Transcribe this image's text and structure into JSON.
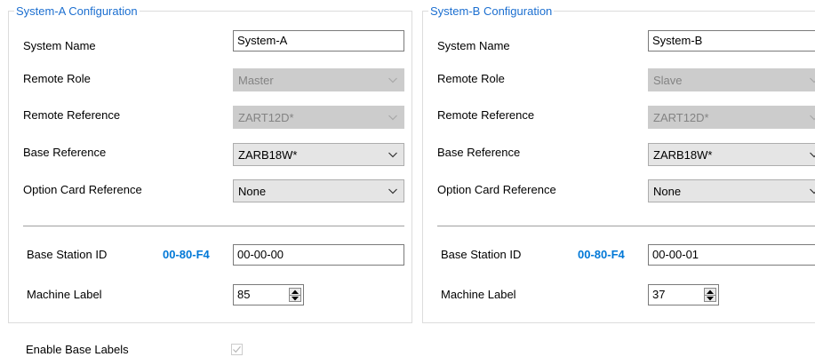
{
  "systemA": {
    "title": "System-A Configuration",
    "labels": {
      "system_name": "System Name",
      "remote_role": "Remote Role",
      "remote_reference": "Remote Reference",
      "base_reference": "Base Reference",
      "option_card_reference": "Option Card Reference",
      "base_station_id": "Base Station ID",
      "machine_label": "Machine Label"
    },
    "system_name": "System-A",
    "remote_role": "Master",
    "remote_reference": "ZART12D*",
    "base_reference": "ZARB18W*",
    "option_card_reference": "None",
    "mac_prefix": "00-80-F4",
    "base_station_id": "00-00-00",
    "machine_label": "85"
  },
  "systemB": {
    "title": "System-B Configuration",
    "labels": {
      "system_name": "System Name",
      "remote_role": "Remote Role",
      "remote_reference": "Remote Reference",
      "base_reference": "Base Reference",
      "option_card_reference": "Option Card Reference",
      "base_station_id": "Base Station ID",
      "machine_label": "Machine Label"
    },
    "system_name": "System-B",
    "remote_role": "Slave",
    "remote_reference": "ZART12D*",
    "base_reference": "ZARB18W*",
    "option_card_reference": "None",
    "mac_prefix": "00-80-F4",
    "base_station_id": "00-00-01",
    "machine_label": "37"
  },
  "enable_base_labels": {
    "label": "Enable Base Labels",
    "checked": true,
    "enabled": false
  },
  "colors": {
    "legend": "#1c6fd0",
    "mac_prefix": "#0078d7",
    "disabled_fill": "#cccccc"
  }
}
